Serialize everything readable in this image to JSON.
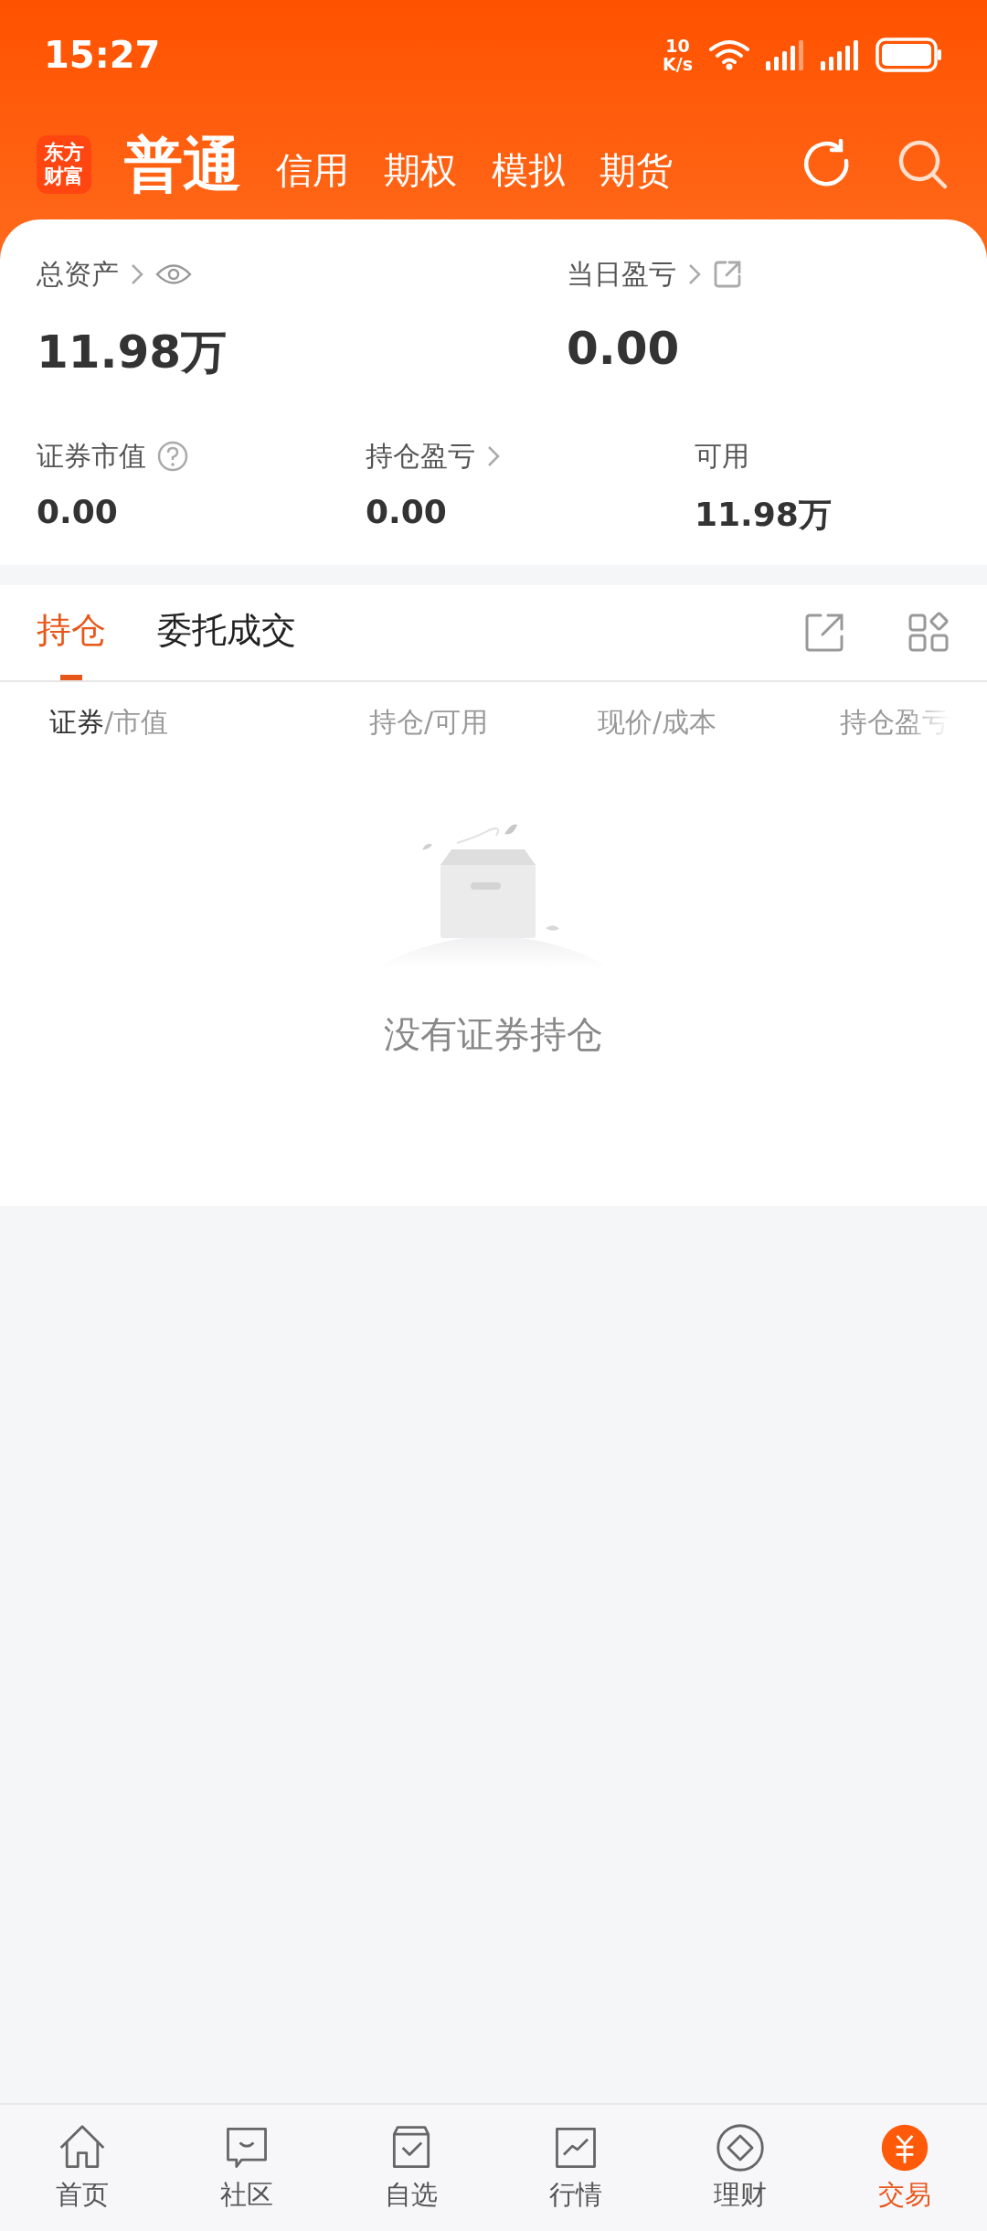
{
  "status_bar": {
    "time": "15:27",
    "speed_value": "10",
    "speed_unit": "K/s"
  },
  "header": {
    "logo_text": "东方财富",
    "tabs": [
      {
        "label": "普通",
        "selected": true
      },
      {
        "label": "信用",
        "selected": false
      },
      {
        "label": "期权",
        "selected": false
      },
      {
        "label": "模拟",
        "selected": false
      },
      {
        "label": "期货",
        "selected": false
      }
    ]
  },
  "summary": {
    "top": [
      {
        "label": "总资产",
        "value": "11.98万"
      },
      {
        "label": "当日盈亏",
        "value": "0.00"
      }
    ],
    "bottom": [
      {
        "label": "证券市值",
        "value": "0.00"
      },
      {
        "label": "持仓盈亏",
        "value": "0.00"
      },
      {
        "label": "可用",
        "value": "11.98万"
      }
    ]
  },
  "tabs": [
    {
      "label": "持仓",
      "selected": true
    },
    {
      "label": "委托成交",
      "selected": false
    }
  ],
  "columns": [
    {
      "primary": "证券",
      "secondary": "/市值"
    },
    {
      "secondary": "持仓/可用"
    },
    {
      "secondary": "现价/成本"
    },
    {
      "secondary": "持仓盈亏"
    }
  ],
  "empty_message": "没有证券持仓",
  "nav": [
    {
      "label": "首页",
      "selected": false
    },
    {
      "label": "社区",
      "selected": false
    },
    {
      "label": "自选",
      "selected": false
    },
    {
      "label": "行情",
      "selected": false
    },
    {
      "label": "理财",
      "selected": false
    },
    {
      "label": "交易",
      "selected": true
    }
  ]
}
